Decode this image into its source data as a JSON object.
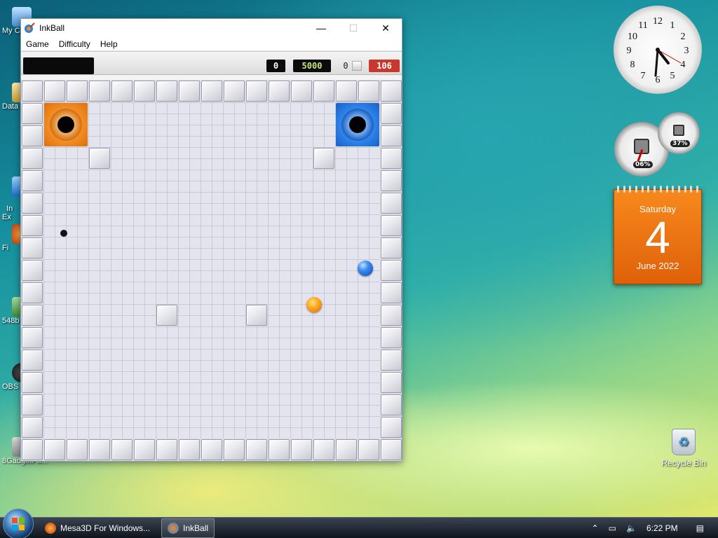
{
  "window": {
    "title": "InkBall",
    "minimize": "—",
    "maximize": "☐",
    "close": "✕"
  },
  "menu": {
    "items": [
      "Game",
      "Difficulty",
      "Help"
    ]
  },
  "scorebar": {
    "player_score": "0",
    "max_score": "5000",
    "ink_count": "0",
    "time_left": "106"
  },
  "desktop": {
    "icons": [
      "My C",
      "Data",
      "In\nEx",
      "Fi",
      "548b",
      "OBS",
      "8GadgetPa..."
    ],
    "recycle_bin": "Recycle Bin"
  },
  "calendar": {
    "day": "Saturday",
    "date": "4",
    "month": "June 2022"
  },
  "cpu_meter": {
    "cpu": "06%",
    "memory": "37%"
  },
  "taskbar": {
    "items": [
      "Mesa3D For Windows...",
      "InkBall"
    ],
    "time": "6:22 PM"
  },
  "colors": {
    "hole_orange": "#f08a20",
    "hole_blue": "#2b7fe8",
    "time_bg": "#c8382c",
    "max_score_text": "#c6e87a"
  }
}
